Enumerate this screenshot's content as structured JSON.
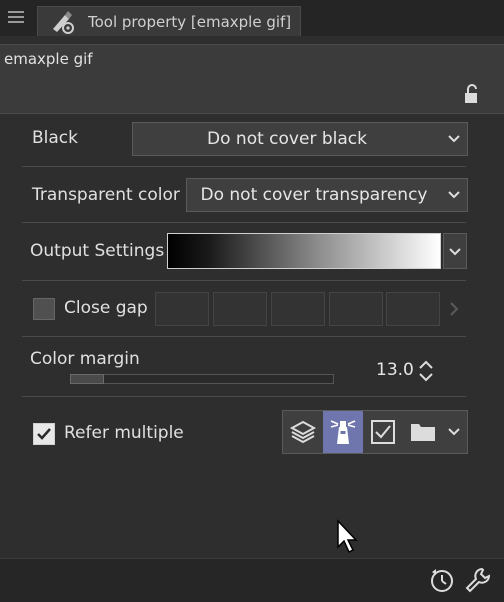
{
  "panel": {
    "tab_title": "Tool property [emaxple gif]",
    "tool_name": "emaxple gif"
  },
  "properties": {
    "black": {
      "label": "Black",
      "value": "Do not cover black"
    },
    "transparent": {
      "label": "Transparent color",
      "value": "Do not cover transparency"
    },
    "output": {
      "label": "Output Settings"
    },
    "close_gap": {
      "label": "Close gap",
      "checked": false
    },
    "color_margin": {
      "label": "Color margin",
      "value": "13.0",
      "level": 0.13
    },
    "refer_multiple": {
      "label": "Refer multiple",
      "checked": true
    }
  },
  "icons": {
    "menu": "hamburger-icon",
    "tab": "tool-property-icon",
    "lock": "lock-icon",
    "chevron": "chevron-down-icon",
    "layers": "layers-icon",
    "lighthouse": "reference-layer-icon",
    "check": "selected-layer-icon",
    "folder": "folder-icon",
    "clock": "reset-icon",
    "wrench": "settings-icon"
  },
  "colors": {
    "accent": "#6e76ad",
    "panel_bg": "#2e2e2e"
  }
}
